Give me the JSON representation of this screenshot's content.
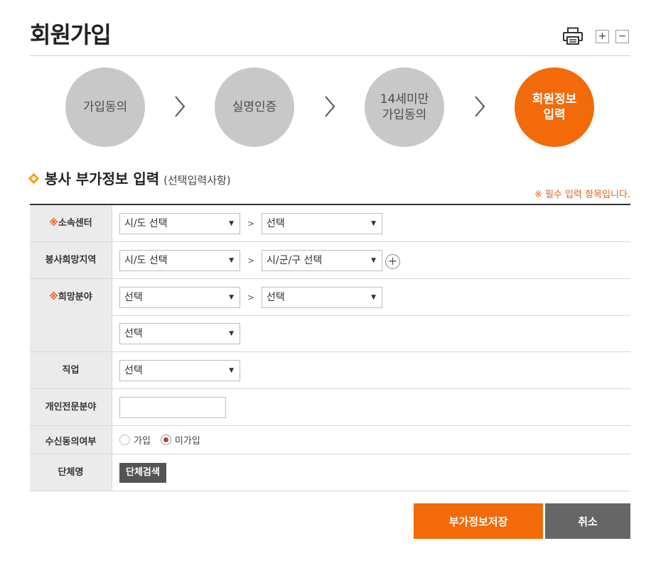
{
  "page": {
    "title": "회원가입",
    "zoom_in_label": "+",
    "zoom_out_label": "−"
  },
  "icons": {
    "print": "printer-icon",
    "step_arrow": "chevron-right-icon",
    "section_bullet": "diamond-icon",
    "add": "plus-circle-icon"
  },
  "colors": {
    "accent": "#f26a0a",
    "step_inactive": "#c8c8c8",
    "required_mark": "#e4621a",
    "dark_button": "#555555",
    "cancel_button": "#666666"
  },
  "steps": [
    {
      "line1": "가입동의",
      "line2": "",
      "active": false
    },
    {
      "line1": "실명인증",
      "line2": "",
      "active": false
    },
    {
      "line1": "14세미만",
      "line2": "가입동의",
      "active": false
    },
    {
      "line1": "회원정보",
      "line2": "입력",
      "active": true
    }
  ],
  "section": {
    "title": "봉사 부가정보 입력",
    "subtitle": "(선택입력사항)",
    "required_note": "※ 필수 입력 항목입니다."
  },
  "form": {
    "required_mark": "※",
    "separator": ">",
    "affiliation": {
      "label": "소속센터",
      "select1": "시/도 선택",
      "select2": "선택"
    },
    "region": {
      "label": "봉사희망지역",
      "select1": "시/도 선택",
      "select2": "시/군/구 선택",
      "add_label": "+"
    },
    "field": {
      "label": "희망분야",
      "select1": "선택",
      "select2": "선택",
      "select3": "선택"
    },
    "job": {
      "label": "직업",
      "select1": "선택"
    },
    "specialty": {
      "label": "개인전문분야",
      "value": ""
    },
    "consent": {
      "label": "수신동의여부",
      "options": [
        "가입",
        "미가입"
      ],
      "selected": "미가입"
    },
    "group": {
      "label": "단체명",
      "button": "단체검색"
    }
  },
  "actions": {
    "save": "부가정보저장",
    "cancel": "취소"
  }
}
